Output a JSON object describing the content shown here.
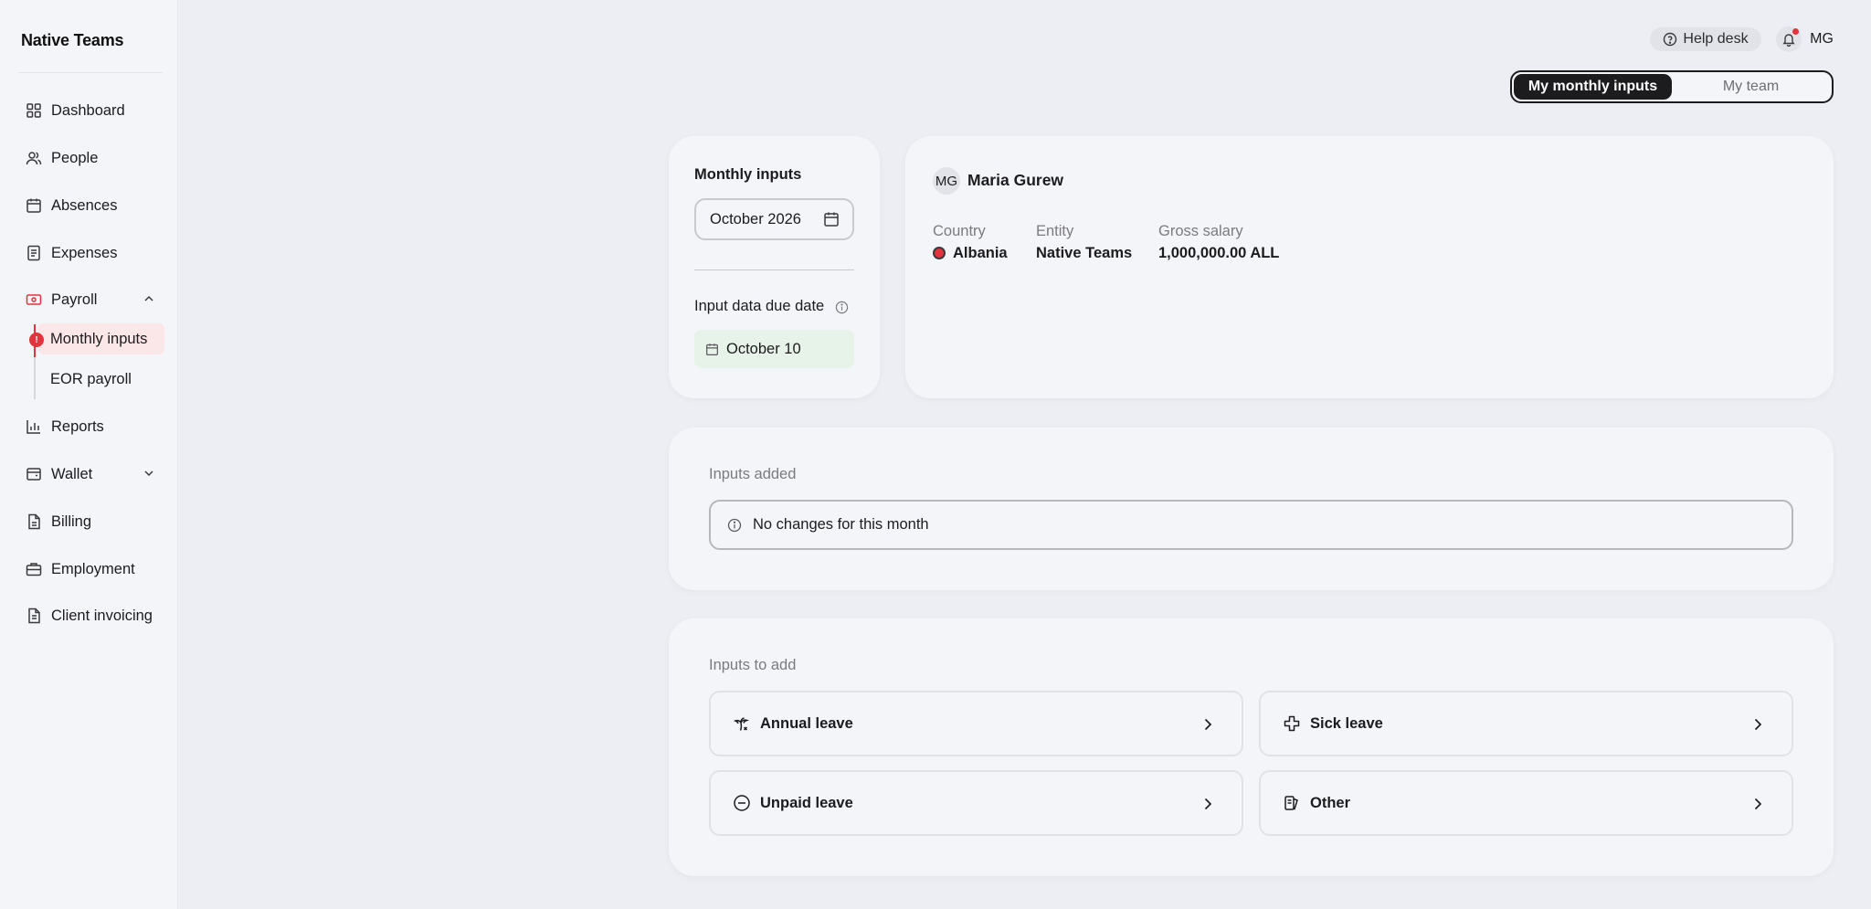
{
  "app": {
    "logo_text": "Native Teams"
  },
  "sidebar": {
    "items": [
      {
        "label": "Dashboard",
        "icon": "dashboard-icon"
      },
      {
        "label": "People",
        "icon": "people-icon"
      },
      {
        "label": "Absences",
        "icon": "calendar-icon"
      },
      {
        "label": "Expenses",
        "icon": "receipt-icon"
      },
      {
        "label": "Payroll",
        "icon": "payroll-icon"
      },
      {
        "label": "Reports",
        "icon": "chart-icon"
      },
      {
        "label": "Wallet",
        "icon": "wallet-icon"
      },
      {
        "label": "Billing",
        "icon": "billing-icon"
      },
      {
        "label": "Employment",
        "icon": "briefcase-icon"
      },
      {
        "label": "Client invoicing",
        "icon": "invoice-icon"
      }
    ],
    "payroll_sub": [
      {
        "label": "Monthly inputs",
        "active": true,
        "badge": "!"
      },
      {
        "label": "EOR payroll",
        "active": false
      }
    ]
  },
  "header": {
    "help_label": "Help desk",
    "user_initials": "MG",
    "toggle": {
      "active": "My monthly inputs",
      "inactive": "My team"
    }
  },
  "monthly": {
    "title": "Monthly inputs",
    "selected_month": "October 2026",
    "due_label": "Input data due date",
    "due_date": "October 10"
  },
  "employee": {
    "initials": "MG",
    "name": "Maria Gurew",
    "country_label": "Country",
    "country": "Albania",
    "entity_label": "Entity",
    "entity": "Native Teams",
    "salary_label": "Gross salary",
    "salary": "1,000,000.00 ALL"
  },
  "inputs_added": {
    "title": "Inputs added",
    "notice": "No changes for this month"
  },
  "inputs_to_add": {
    "title": "Inputs to add",
    "options": [
      "Annual leave",
      "Sick leave",
      "Unpaid leave",
      "Other"
    ]
  },
  "colors": {
    "accent": "#e2343d",
    "dark": "#1c1c1e",
    "due_bg": "#e7f2e8",
    "active_bg": "#fbe6e8"
  }
}
